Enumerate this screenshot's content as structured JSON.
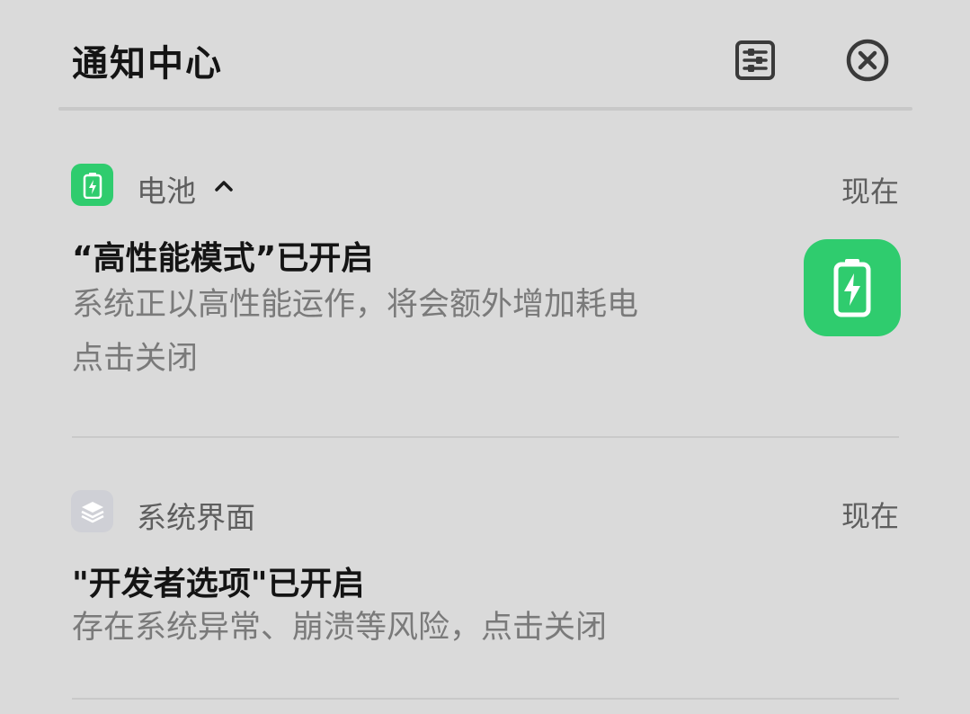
{
  "header": {
    "title": "通知中心",
    "settings_icon": "notification-settings-icon",
    "close_icon": "close-all-icon"
  },
  "notifications": [
    {
      "app_name": "电池",
      "app_icon": "battery-icon",
      "expand_icon": "chevron-up-icon",
      "time": "现在",
      "title": "“高性能模式”已开启",
      "body_line1": "系统正以高性能运作，将会额外增加耗电",
      "body_line2": "点击关闭",
      "large_icon": "battery-charging-icon",
      "accent_color": "#2fcc6e"
    },
    {
      "app_name": "系统界面",
      "app_icon": "layers-icon",
      "time": "现在",
      "title": "\"开发者选项\"已开启",
      "body_line1": "存在系统异常、崩溃等风险，点击关闭"
    }
  ]
}
